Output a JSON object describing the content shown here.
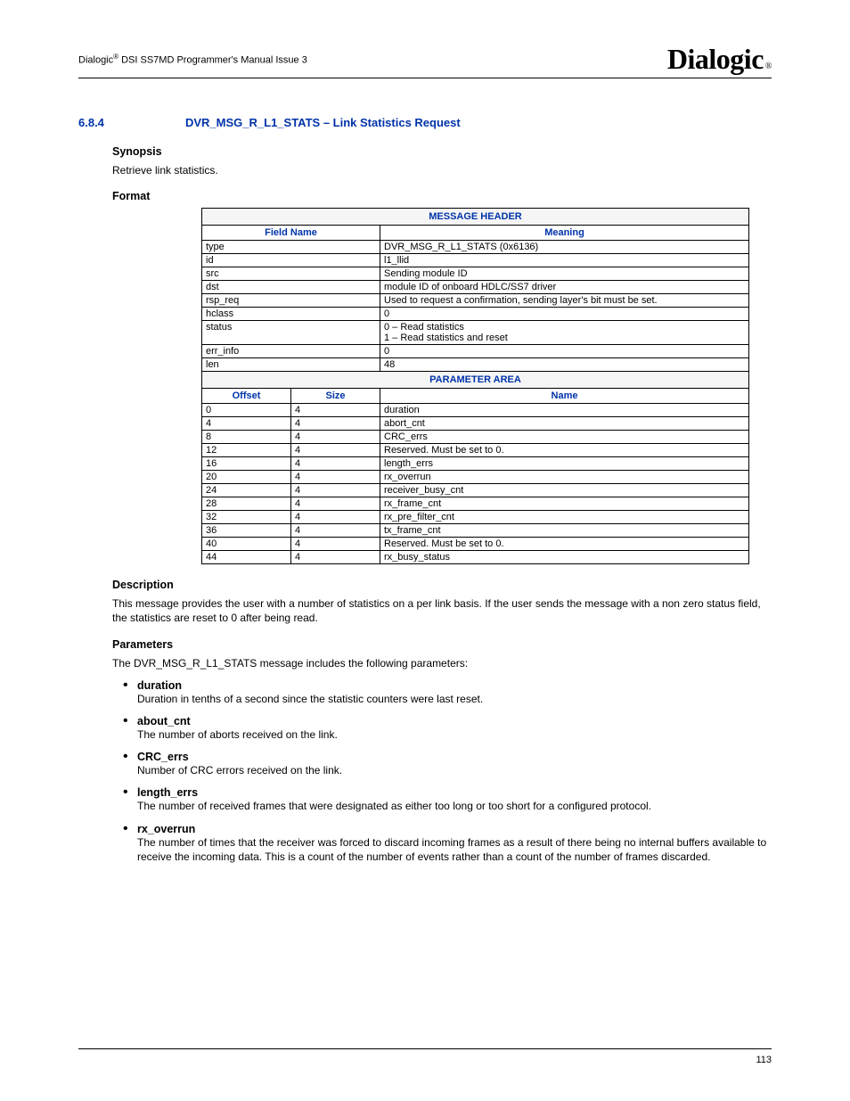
{
  "header": {
    "text_prefix": "Dialogic",
    "text_suffix": " DSI SS7MD Programmer's Manual  Issue 3",
    "logo": "Dialogic",
    "logo_reg": "®"
  },
  "section": {
    "number": "6.8.4",
    "title": "DVR_MSG_R_L1_STATS – Link Statistics Request"
  },
  "synopsis": {
    "heading": "Synopsis",
    "text": "Retrieve link statistics."
  },
  "format": {
    "heading": "Format",
    "msg_header_title": "MESSAGE HEADER",
    "field_name_label": "Field Name",
    "meaning_label": "Meaning",
    "rows": [
      {
        "field": "type",
        "meaning": "DVR_MSG_R_L1_STATS (0x6136)"
      },
      {
        "field": "id",
        "meaning": "l1_llid"
      },
      {
        "field": "src",
        "meaning": "Sending module ID"
      },
      {
        "field": "dst",
        "meaning": "module ID of onboard HDLC/SS7 driver"
      },
      {
        "field": "rsp_req",
        "meaning": "Used to request a confirmation, sending layer's bit must be set."
      },
      {
        "field": "hclass",
        "meaning": "0"
      },
      {
        "field": "status",
        "meaning": "0 – Read statistics\n1 – Read statistics and reset"
      },
      {
        "field": "err_info",
        "meaning": "0"
      },
      {
        "field": "len",
        "meaning": "48"
      }
    ],
    "param_area_title": "PARAMETER AREA",
    "offset_label": "Offset",
    "size_label": "Size",
    "name_label": "Name",
    "param_rows": [
      {
        "offset": "0",
        "size": "4",
        "name": "duration"
      },
      {
        "offset": "4",
        "size": "4",
        "name": "abort_cnt"
      },
      {
        "offset": "8",
        "size": "4",
        "name": "CRC_errs"
      },
      {
        "offset": "12",
        "size": "4",
        "name": "Reserved. Must be set to 0."
      },
      {
        "offset": "16",
        "size": "4",
        "name": "length_errs"
      },
      {
        "offset": "20",
        "size": "4",
        "name": "rx_overrun"
      },
      {
        "offset": "24",
        "size": "4",
        "name": "receiver_busy_cnt"
      },
      {
        "offset": "28",
        "size": "4",
        "name": "rx_frame_cnt"
      },
      {
        "offset": "32",
        "size": "4",
        "name": "rx_pre_filter_cnt"
      },
      {
        "offset": "36",
        "size": "4",
        "name": "tx_frame_cnt"
      },
      {
        "offset": "40",
        "size": "4",
        "name": "Reserved. Must be set to 0."
      },
      {
        "offset": "44",
        "size": "4",
        "name": "rx_busy_status"
      }
    ]
  },
  "description": {
    "heading": "Description",
    "text": "This message provides the user with a number of statistics on a per link basis. If the user sends the message with a non zero status field, the statistics are reset to 0 after being read."
  },
  "parameters": {
    "heading": "Parameters",
    "intro": "The DVR_MSG_R_L1_STATS message includes the following parameters:",
    "items": [
      {
        "name": "duration",
        "desc": "Duration in tenths of a second since the statistic counters were last reset."
      },
      {
        "name": "about_cnt",
        "desc": "The number of aborts received on the link."
      },
      {
        "name": "CRC_errs",
        "desc": "Number of CRC errors received on the link."
      },
      {
        "name": "length_errs",
        "desc": "The number of received frames that were designated as either too long or too short for a configured protocol."
      },
      {
        "name": "rx_overrun",
        "desc": "The number of times that the receiver was forced to discard incoming frames as a result of there being no internal buffers available to receive the incoming data. This is a count of the number of events rather than a count of the number of frames discarded."
      }
    ]
  },
  "footer": {
    "page_number": "113"
  }
}
